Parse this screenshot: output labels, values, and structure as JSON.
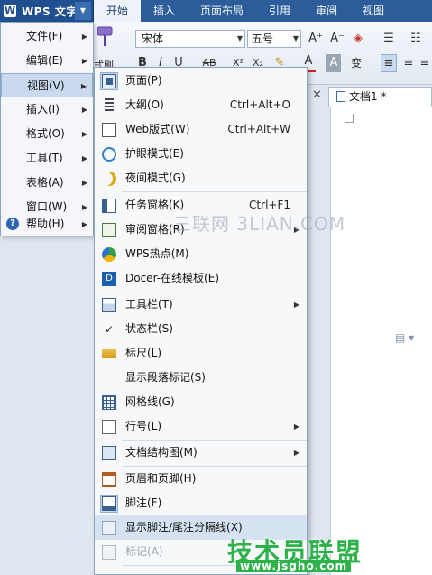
{
  "app": {
    "logo_letter": "W",
    "menu_button": "WPS 文字"
  },
  "ribbon": {
    "tabs": [
      "开始",
      "插入",
      "页面布局",
      "引用",
      "审阅",
      "视图"
    ],
    "format_painter_label": "式刷",
    "font_name": "宋体",
    "font_size": "五号",
    "grow_font": "A⁺",
    "shrink_font": "A⁻",
    "bold": "B",
    "italic": "I",
    "underline": "U",
    "strike": "AB",
    "superscript": "X²",
    "subscript": "X₂",
    "font_color": "A",
    "char_shade": "A"
  },
  "document": {
    "tab_title": "文档1 *",
    "close_glyph": "✕"
  },
  "main_menu": [
    {
      "label": "文件(F)",
      "arrow": true
    },
    {
      "label": "编辑(E)",
      "arrow": true
    },
    {
      "label": "视图(V)",
      "arrow": true,
      "highlighted": true
    },
    {
      "label": "插入(I)",
      "arrow": true
    },
    {
      "label": "格式(O)",
      "arrow": true
    },
    {
      "label": "工具(T)",
      "arrow": true
    },
    {
      "label": "表格(A)",
      "arrow": true
    },
    {
      "label": "窗口(W)",
      "arrow": true
    },
    {
      "label": "帮助(H)",
      "arrow": true,
      "icon": "help-icon"
    }
  ],
  "view_menu": [
    {
      "label": "页面(P)",
      "icon": "page-view-icon",
      "shortcut": "",
      "selected": true
    },
    {
      "label": "大纲(O)",
      "icon": "outline-view-icon",
      "shortcut": "Ctrl+Alt+O"
    },
    {
      "label": "Web版式(W)",
      "icon": "web-layout-icon",
      "shortcut": "Ctrl+Alt+W"
    },
    {
      "label": "护眼模式(E)",
      "icon": "eye-protection-icon",
      "shortcut": ""
    },
    {
      "label": "夜间模式(G)",
      "icon": "night-mode-icon",
      "shortcut": ""
    },
    {
      "label": "任务窗格(K)",
      "icon": "task-pane-icon",
      "shortcut": "Ctrl+F1"
    },
    {
      "label": "审阅窗格(R)",
      "icon": "review-pane-icon",
      "arrow": true
    },
    {
      "label": "WPS热点(M)",
      "icon": "wps-hotspot-icon"
    },
    {
      "label": "Docer-在线模板(E)",
      "icon": "docer-icon"
    },
    {
      "label": "工具栏(T)",
      "icon": "toolbar-icon",
      "arrow": true
    },
    {
      "label": "状态栏(S)",
      "icon": "checkmark-icon"
    },
    {
      "label": "标尺(L)",
      "icon": "ruler-icon"
    },
    {
      "label": "显示段落标记(S)",
      "icon": ""
    },
    {
      "label": "网格线(G)",
      "icon": "gridlines-icon"
    },
    {
      "label": "行号(L)",
      "icon": "line-numbers-icon",
      "arrow": true
    },
    {
      "label": "文档结构图(M)",
      "icon": "document-map-icon",
      "arrow": true
    },
    {
      "label": "页眉和页脚(H)",
      "icon": "header-footer-icon"
    },
    {
      "label": "脚注(F)",
      "icon": "footnote-icon",
      "selected": true
    },
    {
      "label": "显示脚注/尾注分隔线(X)",
      "icon": "footnote-separator-icon",
      "hover": true
    },
    {
      "label": "标记(A)",
      "icon": "markup-icon",
      "disabled": true
    }
  ],
  "watermarks": {
    "site1": "三联网 3LIAN.COM",
    "site2": "技术员联盟",
    "site2_url": "www.jsgho.com"
  }
}
